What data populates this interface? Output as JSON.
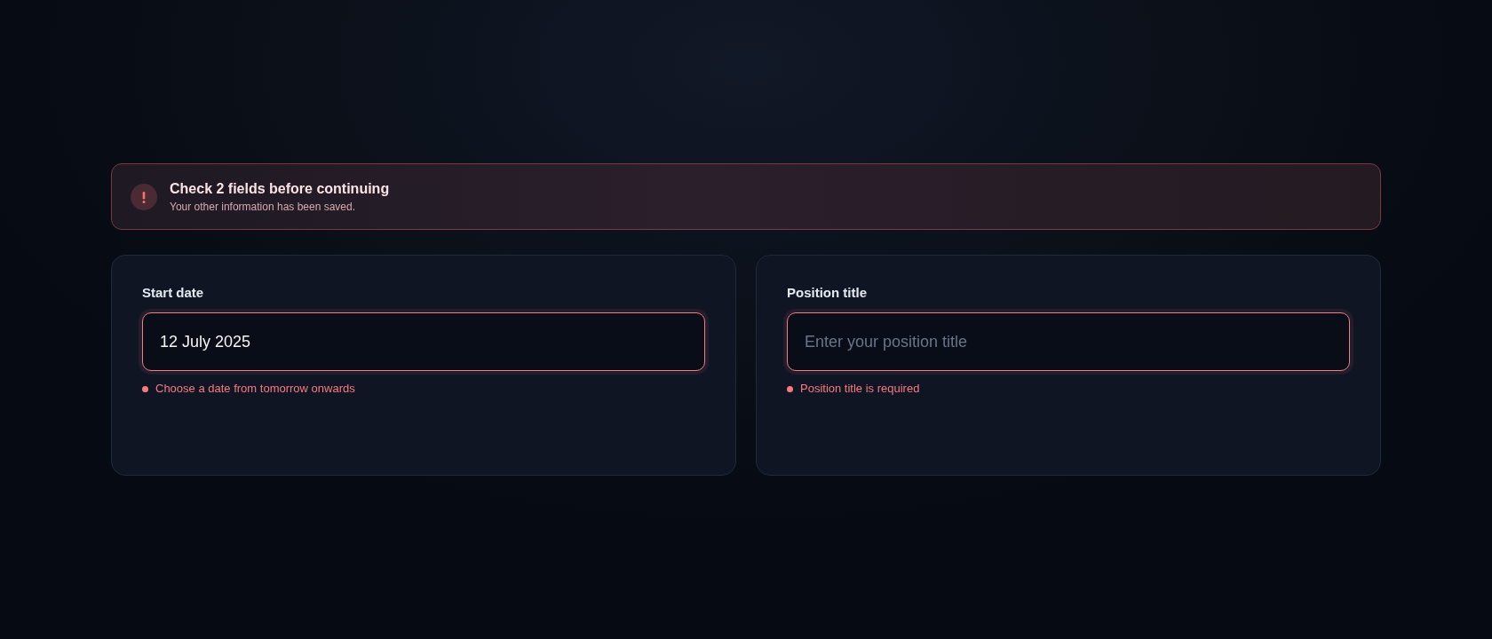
{
  "alert": {
    "title": "Check 2 fields before continuing",
    "message": "Your other information has been saved."
  },
  "fields": [
    {
      "label": "Start date",
      "value": "12 July 2025",
      "error": "Choose a date from tomorrow onwards",
      "invalid": true
    },
    {
      "label": "Position title",
      "placeholder": "Enter your position title",
      "error": "Position title is required",
      "invalid": true
    }
  ]
}
